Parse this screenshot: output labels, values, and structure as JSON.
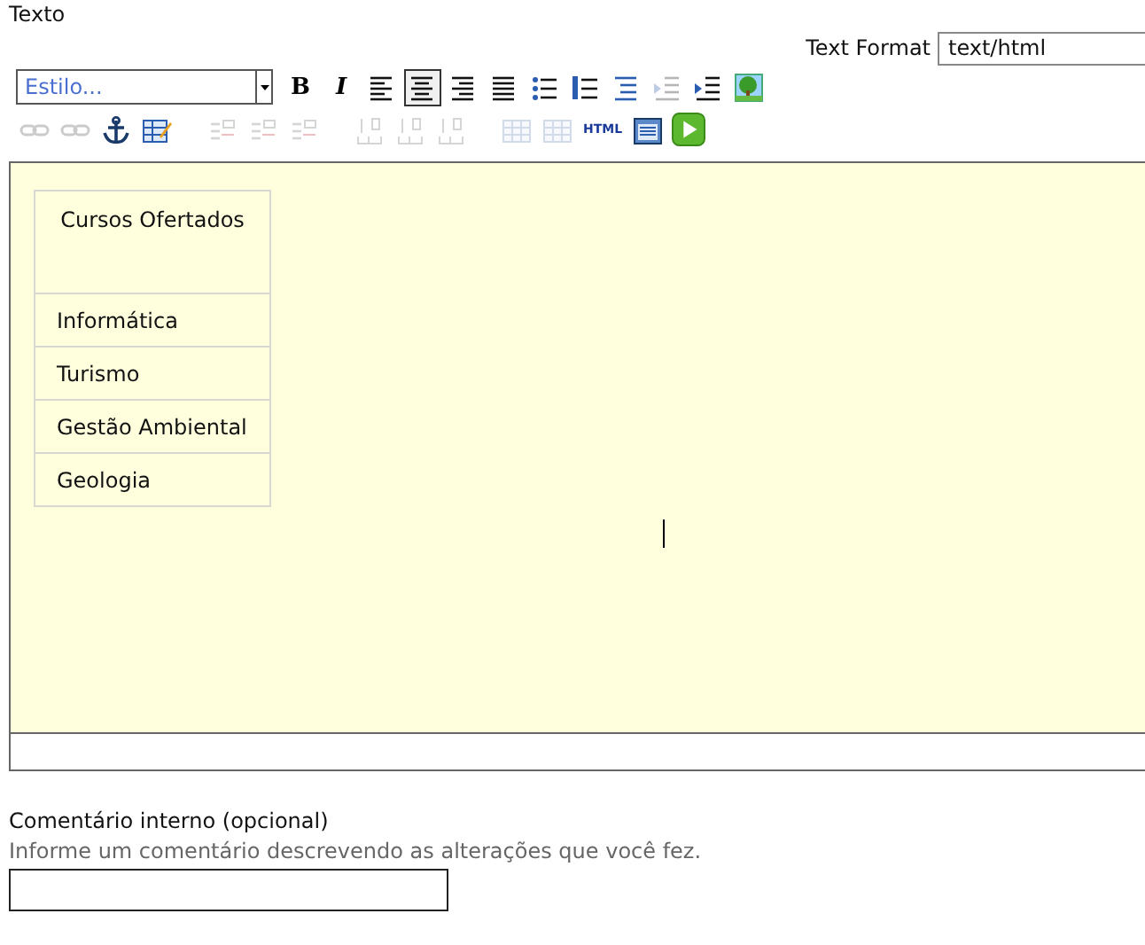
{
  "field_label": "Texto",
  "text_format": {
    "label": "Text Format",
    "value": "text/html"
  },
  "toolbar_rows": [
    [
      {
        "kind": "style",
        "text": "Estilo..."
      },
      {
        "kind": "bold",
        "text": "B",
        "disabled": false,
        "selected": false
      },
      {
        "kind": "italic",
        "text": "I",
        "disabled": false,
        "selected": false
      },
      {
        "kind": "align-left",
        "disabled": false,
        "selected": false
      },
      {
        "kind": "align-center",
        "disabled": false,
        "selected": true
      },
      {
        "kind": "align-right",
        "disabled": false,
        "selected": false
      },
      {
        "kind": "justify",
        "disabled": false,
        "selected": false
      },
      {
        "kind": "bullet-list",
        "disabled": false,
        "selected": false
      },
      {
        "kind": "numbered-list",
        "disabled": false,
        "selected": false
      },
      {
        "kind": "blockquote",
        "disabled": false,
        "selected": false
      },
      {
        "kind": "outdent",
        "disabled": true,
        "selected": false
      },
      {
        "kind": "indent",
        "disabled": false,
        "selected": false
      },
      {
        "kind": "image",
        "disabled": false,
        "selected": false
      }
    ],
    [
      {
        "kind": "link",
        "disabled": true,
        "selected": false
      },
      {
        "kind": "unlink",
        "disabled": true,
        "selected": false
      },
      {
        "kind": "anchor",
        "disabled": false,
        "selected": false
      },
      {
        "kind": "table-edit",
        "disabled": false,
        "selected": false
      },
      {
        "kind": "gap"
      },
      {
        "kind": "row-before",
        "disabled": true,
        "selected": false
      },
      {
        "kind": "row-after",
        "disabled": true,
        "selected": false
      },
      {
        "kind": "row-delete",
        "disabled": true,
        "selected": false
      },
      {
        "kind": "gap"
      },
      {
        "kind": "col-before",
        "disabled": true,
        "selected": false
      },
      {
        "kind": "col-after",
        "disabled": true,
        "selected": false
      },
      {
        "kind": "col-delete",
        "disabled": true,
        "selected": false
      },
      {
        "kind": "gap"
      },
      {
        "kind": "merge",
        "disabled": true,
        "selected": false
      },
      {
        "kind": "split",
        "disabled": true,
        "selected": false
      },
      {
        "kind": "html",
        "text": "HTML",
        "disabled": false,
        "selected": false
      },
      {
        "kind": "template",
        "disabled": false,
        "selected": false
      },
      {
        "kind": "play",
        "disabled": false,
        "selected": false
      }
    ]
  ],
  "table": {
    "header": "Cursos Ofertados",
    "rows": [
      "Informática",
      "Turismo",
      "Gestão Ambiental",
      "Geologia"
    ]
  },
  "comment": {
    "label": "Comentário interno (opcional)",
    "help": "Informe um comentário descrevendo as alterações que você fez."
  }
}
